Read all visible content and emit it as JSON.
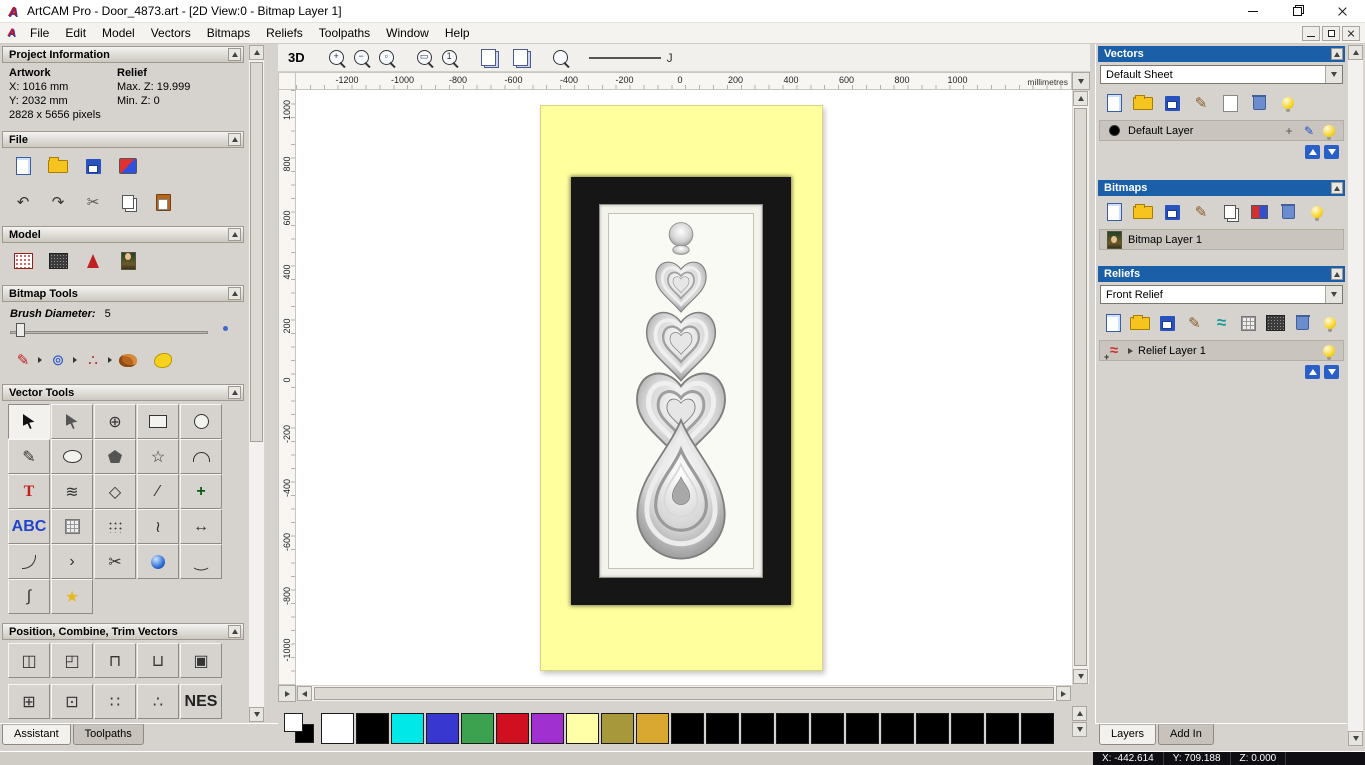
{
  "titlebar": {
    "title": "ArtCAM Pro - Door_4873.art - [2D View:0 - Bitmap Layer 1]"
  },
  "menubar": {
    "items": [
      "File",
      "Edit",
      "Model",
      "Vectors",
      "Bitmaps",
      "Reliefs",
      "Toolpaths",
      "Window",
      "Help"
    ]
  },
  "toolbar": {
    "view3d": "3D",
    "line_handle": "J"
  },
  "ruler": {
    "h_ticks": [
      "-1200",
      "-1000",
      "-800",
      "-600",
      "-400",
      "-200",
      "0",
      "200",
      "400",
      "600",
      "800",
      "1000"
    ],
    "v_ticks": [
      "1000",
      "800",
      "600",
      "400",
      "200",
      "0",
      "-200",
      "-400",
      "-600",
      "-800",
      "-1000"
    ],
    "units": "millimetres"
  },
  "panels": {
    "assistant": {
      "project": {
        "title": "Project Information",
        "artwork_heading": "Artwork",
        "relief_heading": "Relief",
        "x": "X: 1016 mm",
        "y": "Y: 2032 mm",
        "pixels": "2828 x 5656 pixels",
        "max_z": "Max. Z: 19.999",
        "min_z": "Min. Z: 0"
      },
      "file_title": "File",
      "model_title": "Model",
      "bitmap_title": "Bitmap Tools",
      "brush_label": "Brush Diameter:",
      "brush_value": "5",
      "vector_title": "Vector Tools",
      "position_title": "Position, Combine, Trim Vectors",
      "tabs": [
        {
          "label": "Assistant",
          "active": true
        },
        {
          "label": "Toolpaths",
          "active": false
        }
      ]
    },
    "layers": {
      "vectors": {
        "title": "Vectors",
        "sheet": "Default Sheet",
        "layer": "Default Layer"
      },
      "bitmaps": {
        "title": "Bitmaps",
        "layer": "Bitmap Layer 1"
      },
      "reliefs": {
        "title": "Reliefs",
        "selected": "Front Relief",
        "layer": "Relief Layer 1"
      },
      "tabs": [
        {
          "label": "Layers",
          "active": true
        },
        {
          "label": "Add In",
          "active": false
        }
      ]
    }
  },
  "palette": {
    "colors": [
      "#ffffff",
      "#000000",
      "#00e8e8",
      "#3838d0",
      "#3da24f",
      "#d01020",
      "#a030d0",
      "#ffffa8",
      "#a8983c",
      "#d8a830",
      "#000000",
      "#000000",
      "#000000",
      "#000000",
      "#000000",
      "#000000",
      "#000000",
      "#000000",
      "#000000",
      "#000000",
      "#000000"
    ]
  },
  "statusbar": {
    "x": "X: -442.614",
    "y": "Y: 709.188",
    "z": "Z: 0.000"
  },
  "icons": {
    "toolbar_a": [
      {
        "name": "zoom-in-icon",
        "type": "mag",
        "g": "+"
      },
      {
        "name": "zoom-out-icon",
        "type": "mag",
        "g": "−"
      },
      {
        "name": "zoom-previous-icon",
        "type": "mag",
        "g": "▫"
      }
    ],
    "toolbar_b": [
      {
        "name": "zoom-fit-icon",
        "type": "mag",
        "g": "▭"
      },
      {
        "name": "zoom-1to1-icon",
        "type": "mag",
        "g": "1"
      }
    ],
    "toolbar_c": [
      {
        "name": "snap-toggle-icon",
        "type": "pagetoggle"
      },
      {
        "name": "guides-toggle-icon",
        "type": "pagetoggle"
      }
    ],
    "toolbar_d": [
      {
        "name": "zoom-objects-icon",
        "type": "mag",
        "g": ""
      }
    ],
    "file_row1": [
      {
        "name": "new-model-icon",
        "type": "page"
      },
      {
        "name": "open-model-icon",
        "type": "folder"
      },
      {
        "name": "save-model-icon",
        "type": "floppy"
      },
      {
        "name": "export-model-icon",
        "type": "export"
      }
    ],
    "file_row2": [
      {
        "name": "undo-icon",
        "type": "glyph",
        "glyph": "↶",
        "color": "#333"
      },
      {
        "name": "redo-icon",
        "type": "glyph",
        "glyph": "↷",
        "color": "#333"
      },
      {
        "name": "cut-icon",
        "type": "glyph",
        "glyph": "✂",
        "color": "#555"
      },
      {
        "name": "copy-icon",
        "type": "copy"
      },
      {
        "name": "paste-icon",
        "type": "paste"
      }
    ],
    "model_row": [
      {
        "name": "greyscale-preview-icon",
        "type": "dither"
      },
      {
        "name": "relief-preview-icon",
        "type": "texture"
      },
      {
        "name": "lighting-icon",
        "type": "light"
      },
      {
        "name": "bitmap-preview-icon",
        "type": "portrait"
      }
    ],
    "paint_row": [
      {
        "name": "paint-brush-icon",
        "type": "glyph",
        "glyph": "✎",
        "color": "#c02020",
        "dd": true
      },
      {
        "name": "draw-shapes-icon",
        "type": "glyph",
        "glyph": "⊚",
        "color": "#2050cc",
        "dd": true
      },
      {
        "name": "spray-icon",
        "type": "glyph",
        "glyph": "∴",
        "color": "#c02020",
        "dd": true
      },
      {
        "name": "colour-palette-icon",
        "type": "palette"
      },
      {
        "name": "flood-fill-icon",
        "type": "blob"
      }
    ],
    "vector_grid": [
      {
        "name": "select-vectors-icon",
        "type": "cursor",
        "pressed": true
      },
      {
        "name": "node-editing-icon",
        "type": "cursor2",
        "dd": true
      },
      {
        "name": "transform-vectors-icon",
        "type": "glyph",
        "glyph": "⊕",
        "color": "#333"
      },
      {
        "name": "create-rectangle-icon",
        "type": "rect"
      },
      {
        "name": "create-circle-icon",
        "type": "circle"
      },
      {
        "name": "create-polyline-icon",
        "type": "glyph",
        "glyph": "✎",
        "color": "#333"
      },
      {
        "name": "create-ellipse-icon",
        "type": "ellipse"
      },
      {
        "name": "create-polygon-icon",
        "type": "pentagon"
      },
      {
        "name": "create-star-icon",
        "type": "glyph",
        "glyph": "☆",
        "color": "#333"
      },
      {
        "name": "create-arc-icon",
        "type": "arc"
      },
      {
        "name": "create-text-icon",
        "type": "ttool",
        "glyph": "T"
      },
      {
        "name": "arc-fit-icon",
        "type": "glyph",
        "glyph": "≋",
        "color": "#333"
      },
      {
        "name": "offset-vector-icon",
        "type": "glyph",
        "glyph": "◇",
        "color": "#333"
      },
      {
        "name": "slice-vector-icon",
        "type": "glyph",
        "glyph": "∕",
        "color": "#333"
      },
      {
        "name": "weld-vectors-icon",
        "type": "greenplus",
        "glyph": "+"
      },
      {
        "name": "text-on-curve-icon",
        "type": "abc",
        "glyph": "ABC"
      },
      {
        "name": "envelope-distort-icon",
        "type": "grid"
      },
      {
        "name": "paste-along-curve-icon",
        "type": "dots"
      },
      {
        "name": "nesting-icon",
        "type": "glyph",
        "glyph": "≀",
        "color": "#333"
      },
      {
        "name": "measure-icon",
        "type": "glyph",
        "glyph": "↔",
        "color": "#333"
      },
      {
        "name": "fillet-radius-icon",
        "type": "arc2"
      },
      {
        "name": "join-vectors-icon",
        "type": "glyph",
        "glyph": "›",
        "color": "#333"
      },
      {
        "name": "trim-vectors-icon",
        "type": "glyph",
        "glyph": "✂",
        "color": "#333"
      },
      {
        "name": "interactive-sculpt-icon",
        "type": "sphere"
      },
      {
        "name": "freehand-polyline-icon",
        "type": "glyph",
        "glyph": "‿",
        "color": "#333"
      },
      {
        "name": "cross-section-icon",
        "type": "glyph",
        "glyph": "∫",
        "color": "#333"
      },
      {
        "name": "wrap-star-icon",
        "type": "glyph",
        "glyph": "★",
        "color": "#e8b820"
      }
    ],
    "position_row1": [
      {
        "name": "align-centre-icon",
        "type": "glyph",
        "glyph": "◫",
        "color": "#333"
      },
      {
        "name": "align-left-icon",
        "type": "glyph",
        "glyph": "◰",
        "color": "#333"
      },
      {
        "name": "align-top-icon",
        "type": "glyph",
        "glyph": "⊓",
        "color": "#333"
      },
      {
        "name": "align-bottom-icon",
        "type": "glyph",
        "glyph": "⊔",
        "color": "#333"
      },
      {
        "name": "centre-in-material-icon",
        "type": "glyph",
        "glyph": "▣",
        "color": "#333"
      }
    ],
    "position_row2": [
      {
        "name": "group-vectors-icon",
        "type": "glyph",
        "glyph": "⊞",
        "color": "#333"
      },
      {
        "name": "centre-in-page-icon",
        "type": "glyph",
        "glyph": "⊡",
        "color": "#333"
      },
      {
        "name": "array-copy-icon",
        "type": "glyph",
        "glyph": "∷",
        "color": "#333"
      },
      {
        "name": "scatter-copy-icon",
        "type": "glyph",
        "glyph": "∴",
        "color": "#333"
      },
      {
        "name": "nest-vectors-icon",
        "type": "nes",
        "glyph": "NES"
      }
    ],
    "vectors_row": [
      {
        "name": "new-vector-sheet-icon",
        "type": "page"
      },
      {
        "name": "open-vectors-icon",
        "type": "folder"
      },
      {
        "name": "save-vectors-icon",
        "type": "floppy"
      },
      {
        "name": "import-vectors-icon",
        "type": "glyph",
        "glyph": "✎",
        "color": "#8a5a2a"
      },
      {
        "name": "new-vector-layer-icon",
        "type": "sheet"
      },
      {
        "name": "delete-vector-layer-icon",
        "type": "trash"
      },
      {
        "name": "toggle-all-vectors-visibility-icon",
        "type": "bulb"
      }
    ],
    "vector_layer_tools": [
      {
        "name": "merge-layers-icon",
        "type": "glyph",
        "glyph": "+",
        "color": "#555"
      },
      {
        "name": "edit-layer-colour-icon",
        "type": "glyph",
        "glyph": "✎",
        "color": "#2050cc"
      },
      {
        "name": "layer-visibility-icon",
        "type": "bulb"
      }
    ],
    "bitmaps_row": [
      {
        "name": "new-bitmap-layer-icon",
        "type": "page"
      },
      {
        "name": "open-bitmap-icon",
        "type": "folder"
      },
      {
        "name": "save-bitmap-icon",
        "type": "floppy"
      },
      {
        "name": "paint-bitmap-icon",
        "type": "glyph",
        "glyph": "✎",
        "color": "#8a5a2a"
      },
      {
        "name": "copy-bitmap-icon",
        "type": "copy"
      },
      {
        "name": "adjust-contrast-icon",
        "type": "contrast"
      },
      {
        "name": "delete-bitmap-layer-icon",
        "type": "trash"
      },
      {
        "name": "toggle-bitmap-visibility-icon",
        "type": "bulb"
      }
    ],
    "reliefs_row": [
      {
        "name": "new-relief-layer-icon",
        "type": "page"
      },
      {
        "name": "open-relief-icon",
        "type": "folder"
      },
      {
        "name": "save-relief-icon",
        "type": "floppy"
      },
      {
        "name": "paint-relief-icon",
        "type": "glyph",
        "glyph": "✎",
        "color": "#8a5a2a"
      },
      {
        "name": "smooth-relief-icon",
        "type": "wave"
      },
      {
        "name": "calculate-relief-icon",
        "type": "grid"
      },
      {
        "name": "texture-relief-icon",
        "type": "texture"
      },
      {
        "name": "delete-relief-layer-icon",
        "type": "trash"
      },
      {
        "name": "toggle-relief-visibility-icon",
        "type": "bulb"
      }
    ],
    "relief_layer_tools": [
      {
        "name": "relief-layer-visibility-icon",
        "type": "bulb"
      }
    ]
  }
}
